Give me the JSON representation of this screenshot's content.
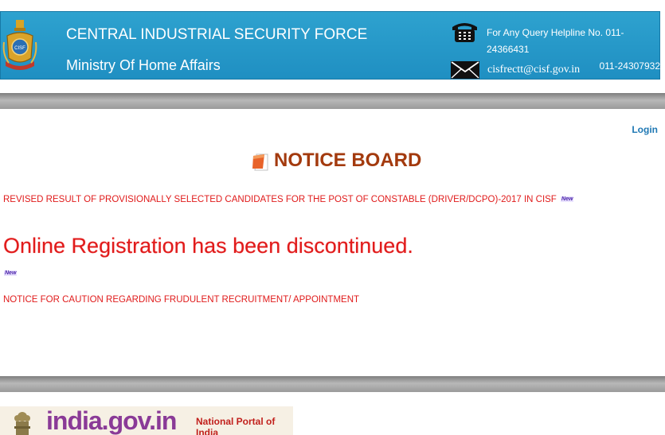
{
  "header": {
    "org_name": "CENTRAL INDUSTRIAL SECURITY FORCE",
    "ministry": "Ministry Of Home Affairs",
    "helpline_text": "For Any Query Helpline No. 011-24366431",
    "helpline_number_2": "011-24307932",
    "email": "cisfrectt@cisf.gov.in",
    "emblem_label": "CISF",
    "header_color": "#2ea2cf"
  },
  "nav": {
    "login_label": "Login"
  },
  "notice_board": {
    "title": "NOTICE BOARD",
    "items": [
      {
        "text": "REVISED RESULT OF PROVISIONALLY SELECTED CANDIDATES FOR THE POST OF CONSTABLE (DRIVER/DCPO)-2017 IN CISF",
        "badge": "New"
      },
      {
        "text": "Online Registration has been discontinued."
      },
      {
        "badge": "New"
      },
      {
        "text": "NOTICE FOR CAUTION REGARDING FRUDULENT RECRUITMENT/ APPOINTMENT"
      }
    ]
  },
  "footer": {
    "portal_logo_text": "india.gov.in",
    "portal_tagline": "National Portal of India"
  },
  "colors": {
    "notice_red": "#e01b1b",
    "title_brown": "#a33a0e",
    "login_blue": "#1f78b4"
  },
  "icons": {
    "emblem": "cisf-emblem-icon",
    "phone": "telephone-icon",
    "mail": "envelope-icon",
    "notice": "notepad-icon",
    "ashoka": "ashoka-emblem-icon"
  }
}
